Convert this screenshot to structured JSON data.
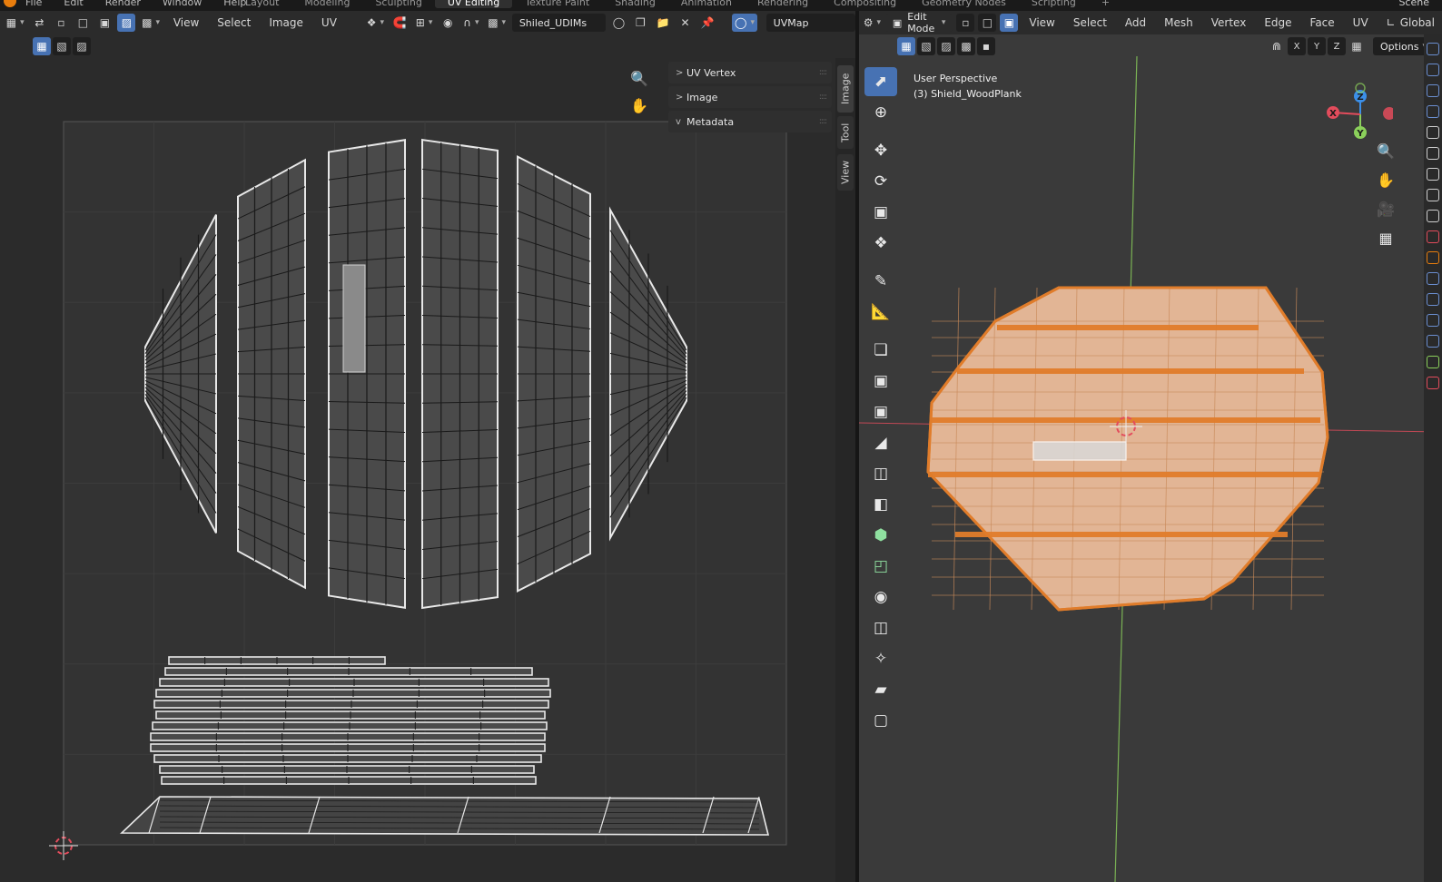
{
  "topbar": {
    "menus": [
      "File",
      "Edit",
      "Render",
      "Window",
      "Help"
    ],
    "workspaces": [
      "Layout",
      "Modeling",
      "Sculpting",
      "UV Editing",
      "Texture Paint",
      "Shading",
      "Animation",
      "Rendering",
      "Compositing",
      "Geometry Nodes",
      "Scripting",
      "+"
    ],
    "active_workspace": "UV Editing",
    "scene_label": "Scene"
  },
  "uv_editor": {
    "menus": {
      "view": "View",
      "select": "Select",
      "image": "Image",
      "uv": "UV"
    },
    "image_name": "Shiled_UDIMs",
    "uv_map": "UVMap",
    "npanel_rows": [
      {
        "label": "UV Vertex",
        "expanded": false,
        "arrow": ">"
      },
      {
        "label": "Image",
        "expanded": false,
        "arrow": ">"
      },
      {
        "label": "Metadata",
        "expanded": true,
        "arrow": "v"
      }
    ],
    "side_tabs": {
      "image": "Image",
      "tool": "Tool",
      "view": "View"
    }
  },
  "viewport": {
    "mode": "Edit Mode",
    "menus": {
      "view": "View",
      "select": "Select",
      "add": "Add",
      "mesh": "Mesh",
      "vertex": "Vertex",
      "edge": "Edge",
      "face": "Face",
      "uv": "UV"
    },
    "orientation": "Global",
    "options_label": "Options",
    "axis_labels": {
      "x": "X",
      "y": "Y",
      "z": "Z"
    },
    "perspective": "User Perspective",
    "object_label": "(3) Shield_WoodPlank"
  },
  "colors": {
    "accent": "#4772b3",
    "mesh_fill": "#e2b595",
    "mesh_edge": "#e07c2a",
    "axis_x": "#e34c5c",
    "axis_y": "#8bd05b",
    "axis_z": "#3b8fe8"
  }
}
